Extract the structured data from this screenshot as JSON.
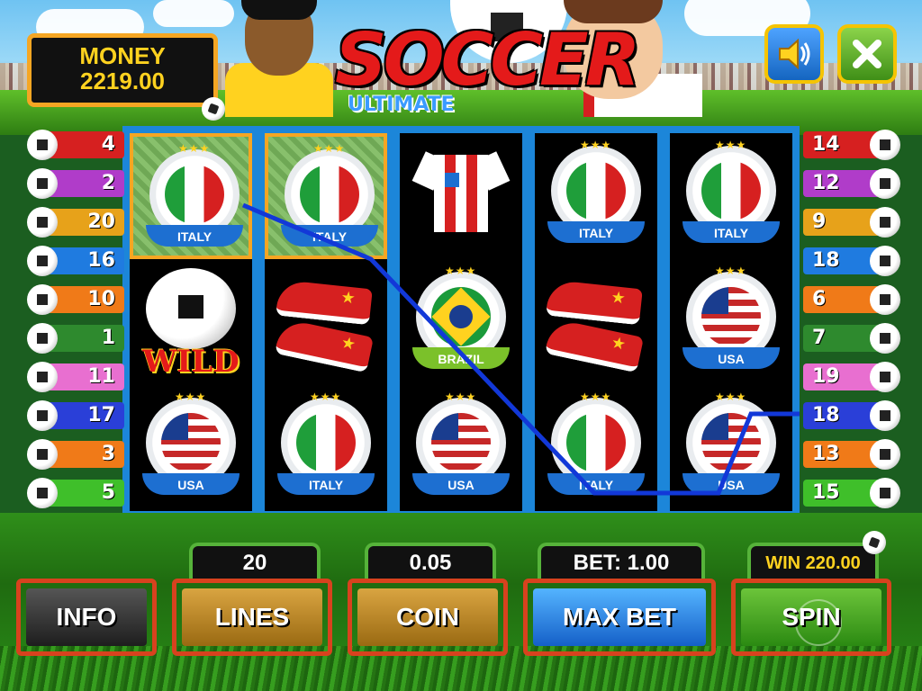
{
  "game": {
    "logo_title": "SOCCER",
    "logo_subtitle": "ULTIMATE"
  },
  "money": {
    "label": "MONEY",
    "value": "2219.00"
  },
  "top_buttons": {
    "sound_icon": "speaker-icon",
    "close_icon": "close-x-icon"
  },
  "lines_left": [
    {
      "number": "4",
      "color": "#d62020"
    },
    {
      "number": "2",
      "color": "#b03cc9"
    },
    {
      "number": "20",
      "color": "#e7a21a"
    },
    {
      "number": "16",
      "color": "#1f7be0"
    },
    {
      "number": "10",
      "color": "#f07a18"
    },
    {
      "number": "1",
      "color": "#2e8a2e"
    },
    {
      "number": "11",
      "color": "#e86fd0"
    },
    {
      "number": "17",
      "color": "#2a3fd8"
    },
    {
      "number": "3",
      "color": "#f07a18"
    },
    {
      "number": "5",
      "color": "#3fbf2a"
    }
  ],
  "lines_right": [
    {
      "number": "14",
      "color": "#d62020"
    },
    {
      "number": "12",
      "color": "#b03cc9"
    },
    {
      "number": "9",
      "color": "#e7a21a"
    },
    {
      "number": "18",
      "color": "#1f7be0"
    },
    {
      "number": "6",
      "color": "#f07a18"
    },
    {
      "number": "7",
      "color": "#2e8a2e"
    },
    {
      "number": "19",
      "color": "#e86fd0"
    },
    {
      "number": "18",
      "color": "#2a3fd8"
    },
    {
      "number": "13",
      "color": "#f07a18"
    },
    {
      "number": "15",
      "color": "#3fbf2a"
    }
  ],
  "reels": [
    [
      {
        "symbol": "flag",
        "label": "ITALY",
        "highlight": true
      },
      {
        "symbol": "wild",
        "label": "WILD"
      },
      {
        "symbol": "flag",
        "label": "USA"
      }
    ],
    [
      {
        "symbol": "flag",
        "label": "ITALY",
        "highlight": true
      },
      {
        "symbol": "shoes"
      },
      {
        "symbol": "flag",
        "label": "ITALY"
      }
    ],
    [
      {
        "symbol": "shirt"
      },
      {
        "symbol": "flag",
        "label": "BRAZIL"
      },
      {
        "symbol": "flag",
        "label": "USA"
      }
    ],
    [
      {
        "symbol": "flag",
        "label": "ITALY"
      },
      {
        "symbol": "shoes"
      },
      {
        "symbol": "flag",
        "label": "ITALY"
      }
    ],
    [
      {
        "symbol": "flag",
        "label": "ITALY"
      },
      {
        "symbol": "flag",
        "label": "USA"
      },
      {
        "symbol": "flag",
        "label": "USA"
      }
    ]
  ],
  "payline_color": "#1238d8",
  "displays": {
    "lines_value": "20",
    "coin_value": "0.05",
    "bet": "BET: 1.00",
    "win": "WIN 220.00"
  },
  "buttons": {
    "info": "INFO",
    "lines": "LINES",
    "coin": "COIN",
    "max_bet": "MAX BET",
    "spin": "SPIN"
  }
}
